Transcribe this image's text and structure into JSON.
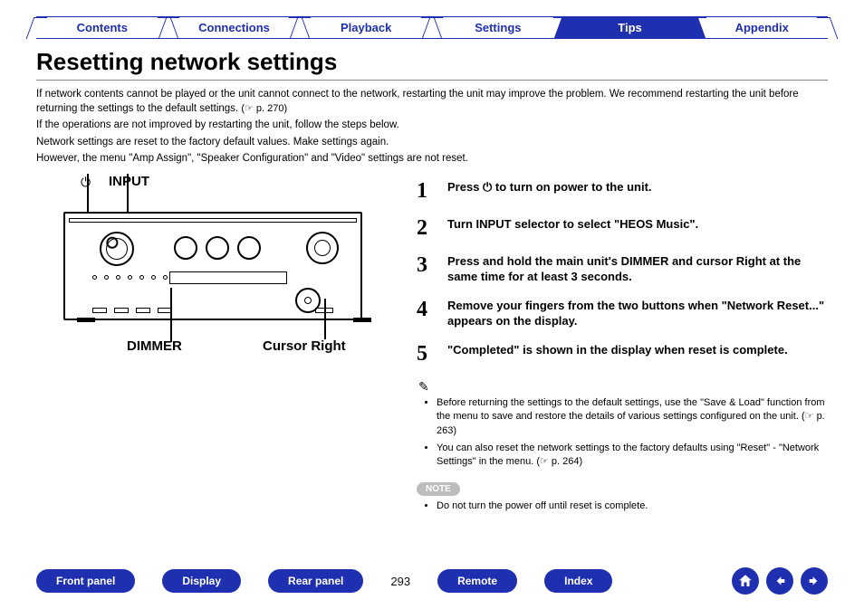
{
  "tabs": {
    "contents": "Contents",
    "connections": "Connections",
    "playback": "Playback",
    "settings": "Settings",
    "tips": "Tips",
    "appendix": "Appendix",
    "active": "tips"
  },
  "page_title": "Resetting network settings",
  "intro": {
    "p1": "If network contents cannot be played or the unit cannot connect to the network, restarting the unit may improve the problem. We recommend restarting the unit before returning the settings to the default settings.",
    "p1_ref": "(☞ p. 270)",
    "p2": "If the operations are not improved by restarting the unit, follow the steps below.",
    "p3": "Network settings are reset to the factory default values. Make settings again.",
    "p4": "However, the menu \"Amp Assign\", \"Speaker Configuration\" and \"Video\" settings are not reset."
  },
  "device_labels": {
    "input": "INPUT",
    "dimmer": "DIMMER",
    "cursor_right": "Cursor Right"
  },
  "steps": [
    {
      "n": "1",
      "text": "Press ⏻ to turn on power to the unit."
    },
    {
      "n": "2",
      "text": "Turn INPUT selector to select \"HEOS Music\"."
    },
    {
      "n": "3",
      "text": "Press and hold the main unit's DIMMER and cursor Right at the same time for at least 3 seconds."
    },
    {
      "n": "4",
      "text": "Remove your fingers from the two buttons when \"Network Reset...\" appears on the display."
    },
    {
      "n": "5",
      "text": "\"Completed\" is shown in the display when reset is complete."
    }
  ],
  "notes": {
    "tip1": "Before returning the settings to the default settings, use the \"Save & Load\" function from the menu to save and restore the details of various settings configured on the unit.",
    "tip1_ref": "(☞ p. 263)",
    "tip2": "You can also reset the network settings to the factory defaults using \"Reset\" - \"Network Settings\" in the menu.",
    "tip2_ref": "(☞ p. 264)",
    "note_label": "NOTE",
    "note1": "Do not turn the power off until reset is complete."
  },
  "bottom": {
    "front_panel": "Front panel",
    "display": "Display",
    "rear_panel": "Rear panel",
    "page_number": "293",
    "remote": "Remote",
    "index": "Index"
  }
}
